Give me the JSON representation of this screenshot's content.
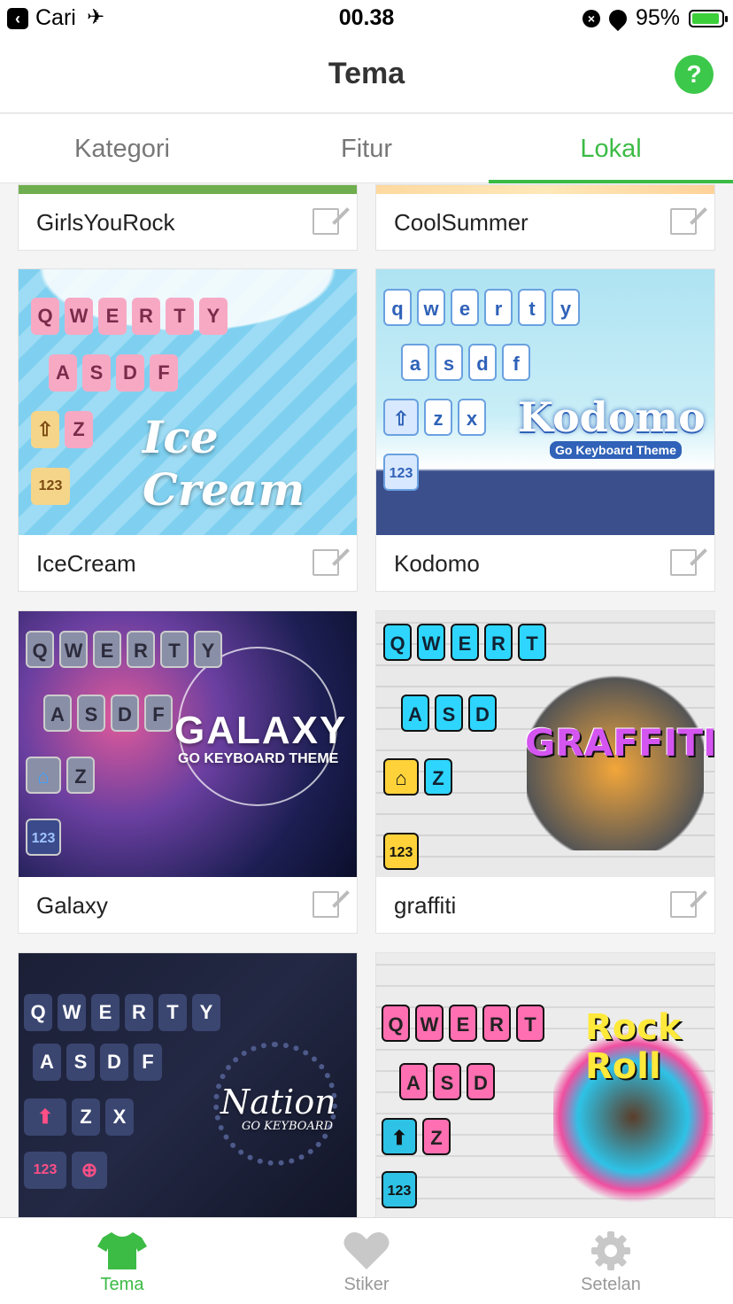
{
  "status_bar": {
    "back_app": "Cari",
    "time": "00.38",
    "battery": "95%"
  },
  "header": {
    "title": "Tema",
    "help_label": "?"
  },
  "tabs": [
    {
      "label": "Kategori",
      "active": false
    },
    {
      "label": "Fitur",
      "active": false
    },
    {
      "label": "Lokal",
      "active": true
    }
  ],
  "themes": [
    {
      "name": "GirlsYouRock",
      "thumb_text": ""
    },
    {
      "name": "CoolSummer",
      "thumb_text": ""
    },
    {
      "name": "IceCream",
      "thumb_text": "Ice Cream"
    },
    {
      "name": "Kodomo",
      "thumb_text": "Kodomo",
      "thumb_sub": "Go Keyboard Theme"
    },
    {
      "name": "Galaxy",
      "thumb_text": "GALAXY",
      "thumb_sub": "GO KEYBOARD THEME"
    },
    {
      "name": "graffiti",
      "thumb_text": "GRAFFITI"
    },
    {
      "name": "",
      "thumb_text": "Nation",
      "thumb_sub": "GO KEYBOARD"
    },
    {
      "name": "",
      "thumb_text": "Rock Roll"
    }
  ],
  "keyboard_letters": {
    "row1": [
      "Q",
      "W",
      "E",
      "R",
      "T",
      "Y"
    ],
    "row2": [
      "A",
      "S",
      "D",
      "F"
    ],
    "row3": [
      "Z",
      "X"
    ],
    "num": "123"
  },
  "bottom_nav": [
    {
      "label": "Tema",
      "icon": "shirt-icon",
      "active": true
    },
    {
      "label": "Stiker",
      "icon": "heart-icon",
      "active": false
    },
    {
      "label": "Setelan",
      "icon": "gear-icon",
      "active": false
    }
  ],
  "colors": {
    "accent": "#3cbb45",
    "help": "#3cc84a"
  }
}
